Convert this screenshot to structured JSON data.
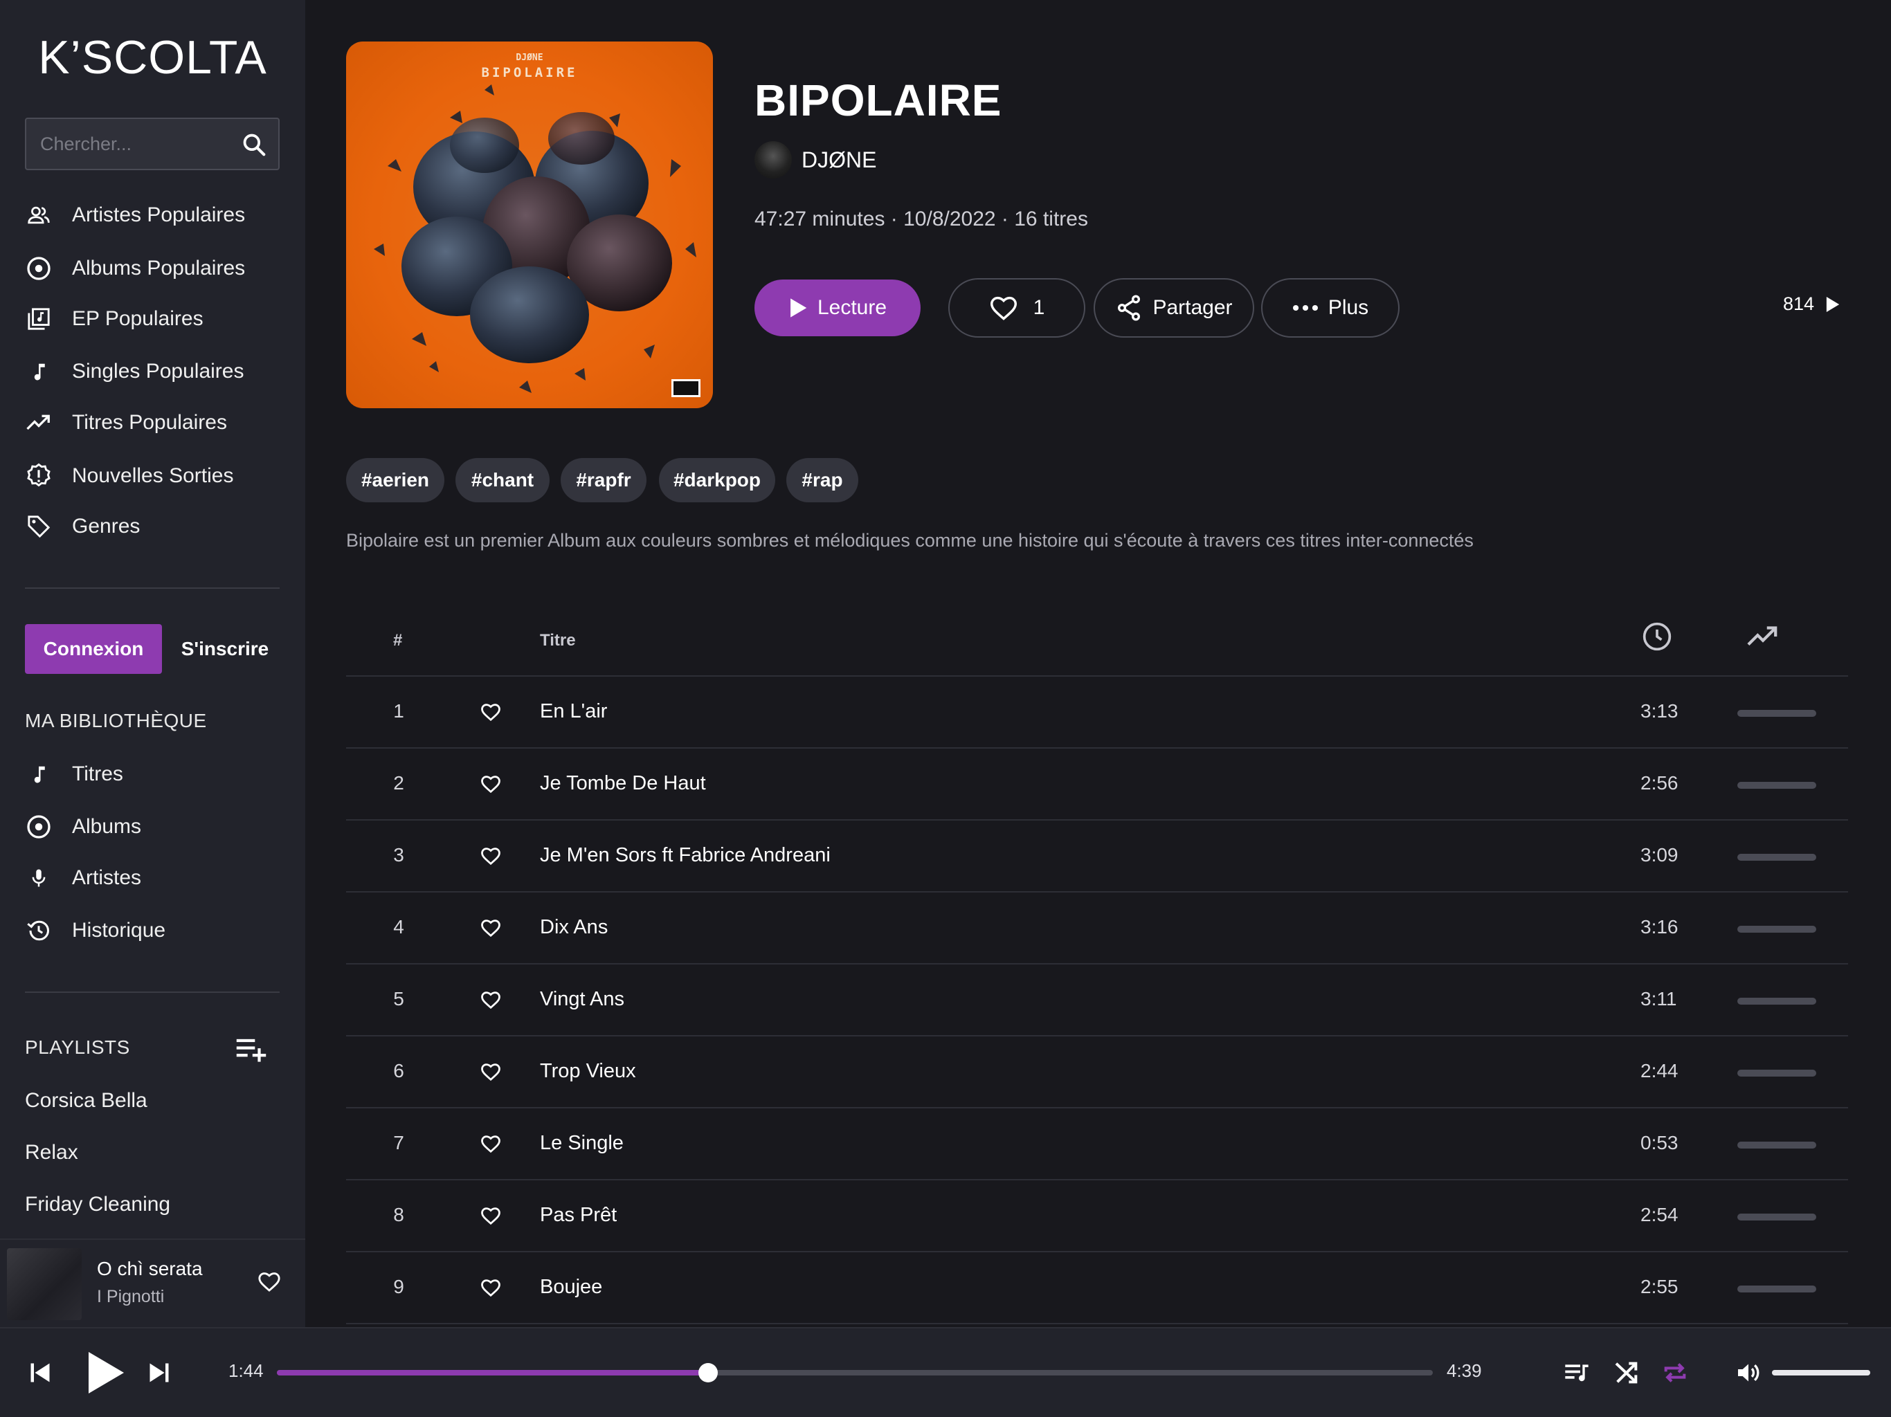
{
  "app": {
    "logo": "K’SCOLTA"
  },
  "search": {
    "placeholder": "Chercher..."
  },
  "nav": {
    "items": [
      {
        "label": "Artistes Populaires",
        "icon": "people-icon"
      },
      {
        "label": "Albums Populaires",
        "icon": "disc-icon"
      },
      {
        "label": "EP Populaires",
        "icon": "library-music-icon"
      },
      {
        "label": "Singles Populaires",
        "icon": "music-note-icon"
      },
      {
        "label": "Titres Populaires",
        "icon": "trending-up-icon"
      },
      {
        "label": "Nouvelles Sorties",
        "icon": "new-releases-icon"
      },
      {
        "label": "Genres",
        "icon": "tag-icon"
      }
    ]
  },
  "auth": {
    "login_label": "Connexion",
    "signup_label": "S'inscrire"
  },
  "library": {
    "heading": "MA BIBLIOTHÈQUE",
    "items": [
      {
        "label": "Titres",
        "icon": "music-note-icon"
      },
      {
        "label": "Albums",
        "icon": "disc-icon"
      },
      {
        "label": "Artistes",
        "icon": "microphone-icon"
      },
      {
        "label": "Historique",
        "icon": "history-icon"
      }
    ]
  },
  "playlists": {
    "heading": "PLAYLISTS",
    "items": [
      "Corsica Bella",
      "Relax",
      "Friday Cleaning"
    ]
  },
  "mini_player": {
    "title": "O chì serata",
    "artist": "I Pignotti"
  },
  "album": {
    "cover_artist": "DJØNE",
    "cover_title": "BIPOLAIRE",
    "title": "BIPOLAIRE",
    "artist": "DJØNE",
    "meta": "47:27 minutes · 10/8/2022 · 16 titres",
    "play_label": "Lecture",
    "likes": "1",
    "share_label": "Partager",
    "more_label": "Plus",
    "plays": "814",
    "tags": [
      "#aerien",
      "#chant",
      "#rapfr",
      "#darkpop",
      "#rap"
    ],
    "description": "Bipolaire est un premier Album aux couleurs sombres et mélodiques comme une histoire qui s'écoute à travers ces titres inter-connectés"
  },
  "tracks_table": {
    "headers": {
      "num": "#",
      "title": "Titre"
    },
    "rows": [
      {
        "num": "1",
        "title": "En L'air",
        "duration": "3:13"
      },
      {
        "num": "2",
        "title": "Je Tombe De Haut",
        "duration": "2:56"
      },
      {
        "num": "3",
        "title": "Je M'en Sors ft Fabrice Andreani",
        "duration": "3:09"
      },
      {
        "num": "4",
        "title": "Dix Ans",
        "duration": "3:16"
      },
      {
        "num": "5",
        "title": "Vingt Ans",
        "duration": "3:11"
      },
      {
        "num": "6",
        "title": "Trop Vieux",
        "duration": "2:44"
      },
      {
        "num": "7",
        "title": "Le Single",
        "duration": "0:53"
      },
      {
        "num": "8",
        "title": "Pas Prêt",
        "duration": "2:54"
      },
      {
        "num": "9",
        "title": "Boujee",
        "duration": "2:55"
      }
    ]
  },
  "player": {
    "elapsed": "1:44",
    "total": "4:39",
    "progress_fraction": 0.373,
    "volume_fraction": 1.0,
    "repeat_active": true
  },
  "colors": {
    "accent": "#8e3bb0",
    "background": "#18181d",
    "sidebar": "#22232b",
    "cover_orange": "#e8640c"
  }
}
